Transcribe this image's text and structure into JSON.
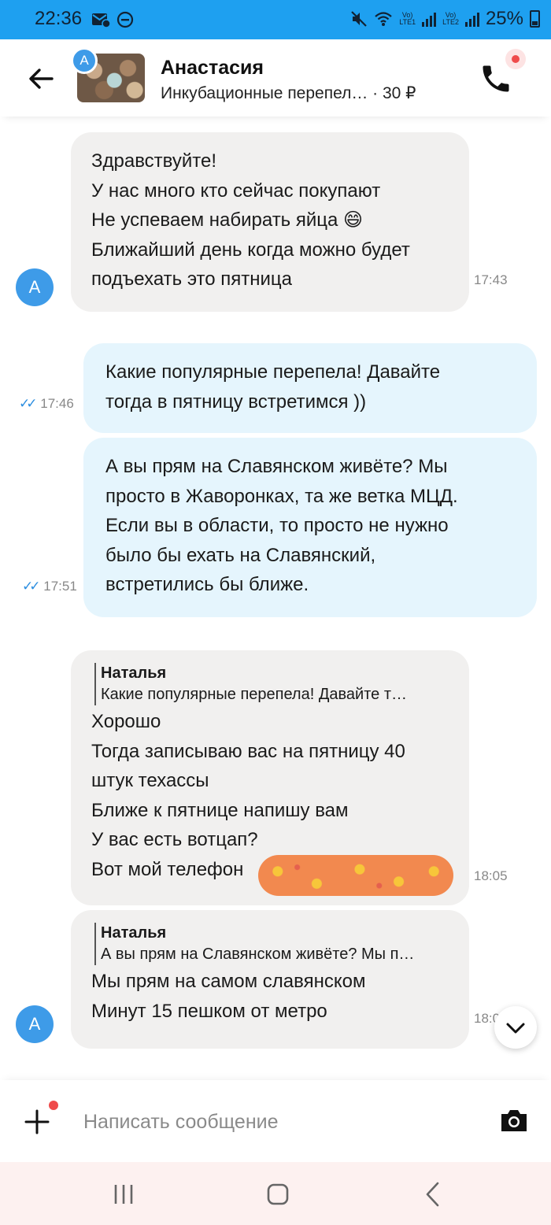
{
  "status_bar": {
    "time": "22:36",
    "left_icons": [
      "mail-icon",
      "dnd-icon"
    ],
    "sim1_tag_top": "Vo)",
    "sim1_tag_bottom": "LTE1",
    "sim2_tag_top": "Vo)",
    "sim2_tag_bottom": "LTE2",
    "battery": "25%"
  },
  "header": {
    "name": "Анастасия",
    "listing": "Инкубационные перепел… · 30 ₽",
    "avatar_letter": "A"
  },
  "messages": [
    {
      "direction": "incoming",
      "lines": [
        "Здравствуйте!",
        "У нас много кто сейчас покупают",
        "Не успеваем набирать яйца 😄",
        "Ближайший день когда можно будет",
        "подъехать это пятница"
      ],
      "time": "17:43",
      "avatar": "A"
    },
    {
      "direction": "outgoing",
      "lines": [
        "Какие популярные перепела! Давайте",
        "тогда в пятницу встретимся ))"
      ],
      "time": "17:46",
      "ticks": "✓✓"
    },
    {
      "direction": "outgoing",
      "lines": [
        "А вы прям на Славянском живёте? Мы",
        "просто в Жаворонках, та же ветка МЦД.",
        "Если вы в области, то просто не нужно",
        "было бы ехать на Славянский,",
        "встретились бы ближе."
      ],
      "time": "17:51",
      "ticks": "✓✓"
    },
    {
      "direction": "incoming",
      "quote_author": "Наталья",
      "quote_text": "Какие популярные перепела! Давайте т…",
      "lines": [
        "Хорошо",
        "Тогда записываю вас на пятницу 40",
        "штук техассы",
        "Ближе к пятнице напишу вам",
        "У вас есть вотцап?",
        "Вот мой телефон"
      ],
      "time": "18:05"
    },
    {
      "direction": "incoming",
      "quote_author": "Наталья",
      "quote_text": "А вы прям на Славянском живёте? Мы п…",
      "lines": [
        "Мы прям на самом славянском",
        "Минут 15 пешком от метро"
      ],
      "time": "18:0",
      "avatar": "A"
    }
  ],
  "composer": {
    "placeholder": "Написать сообщение"
  },
  "colors": {
    "status_bar": "#1ea0f0",
    "incoming_bubble": "#f1f0ef",
    "outgoing_bubble": "#e5f5fd",
    "avatar": "#3e9be8",
    "read_ticks": "#2c8ee0",
    "notification_dot": "#ef4b4b"
  }
}
